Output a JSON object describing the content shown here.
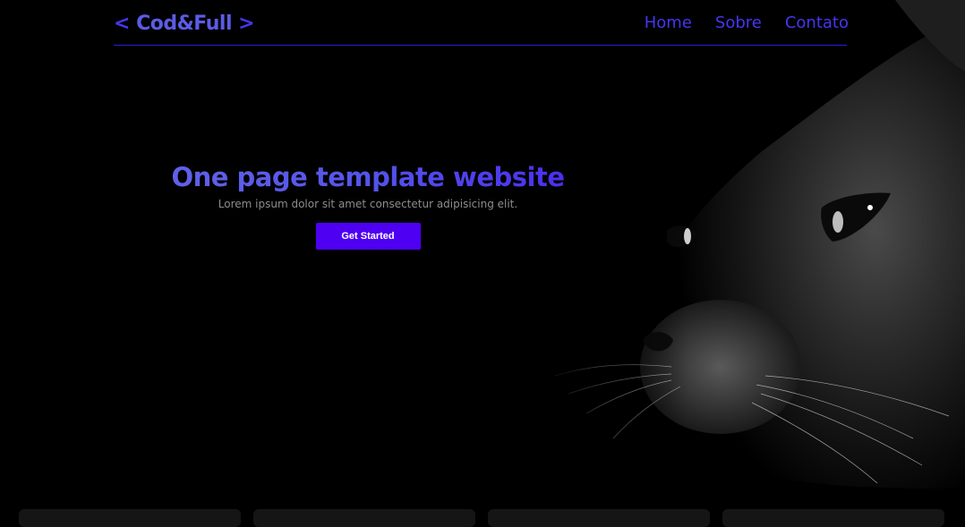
{
  "header": {
    "logo": {
      "open": "<",
      "text": "Cod&Full",
      "close": ">"
    },
    "nav": [
      {
        "label": "Home"
      },
      {
        "label": "Sobre"
      },
      {
        "label": "Contato"
      }
    ]
  },
  "hero": {
    "title": "One page template website",
    "subtitle": "Lorem ipsum dolor sit amet consectetur adipisicing elit.",
    "cta_label": "Get Started",
    "image": "black-cat-photo"
  },
  "colors": {
    "background": "#000000",
    "accent": "#4e00f2",
    "link": "#4636f0",
    "logo": "#5b5ce6",
    "card": "#151515"
  }
}
